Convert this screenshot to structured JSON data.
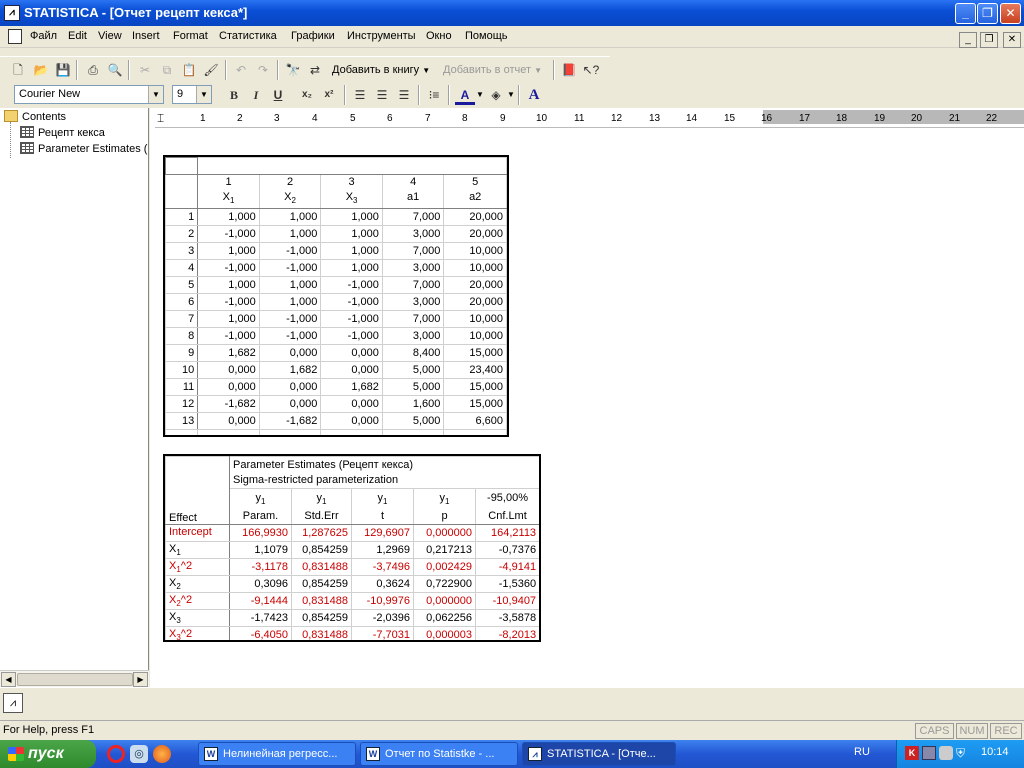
{
  "window": {
    "title": "STATISTICA - [Отчет рецепт кекса*]",
    "app_icon": "statistica-icon"
  },
  "menu": [
    "Файл",
    "Edit",
    "View",
    "Insert",
    "Format",
    "Статистика",
    "Графики",
    "Инструменты",
    "Окно",
    "Помощь"
  ],
  "toolbar": {
    "add_to_workbook": "Добавить в книгу",
    "add_to_report": "Добавить в отчет",
    "font_name": "Courier New",
    "font_size": "9",
    "bold": "B",
    "italic": "I",
    "underline": "U",
    "subscript": "x₂",
    "superscript": "x²",
    "text_color": "A",
    "font_a": "A"
  },
  "tree": {
    "root": "Contents",
    "items": [
      "Рецепт кекса",
      "Parameter Estimates ("
    ]
  },
  "ruler": {
    "ticks": [
      "1",
      "2",
      "3",
      "4",
      "5",
      "6",
      "7",
      "8",
      "9",
      "10",
      "11",
      "12",
      "13",
      "14",
      "15",
      "16",
      "17",
      "18",
      "19",
      "20",
      "21",
      "22"
    ]
  },
  "table1": {
    "col_nums": [
      "1",
      "2",
      "3",
      "4",
      "5"
    ],
    "col_names": [
      "X",
      "X",
      "X",
      "a1",
      "a2"
    ],
    "col_subs": [
      "1",
      "2",
      "3",
      "",
      ""
    ],
    "rows": [
      [
        "1",
        "1,000",
        "1,000",
        "1,000",
        "7,000",
        "20,000"
      ],
      [
        "2",
        "-1,000",
        "1,000",
        "1,000",
        "3,000",
        "20,000"
      ],
      [
        "3",
        "1,000",
        "-1,000",
        "1,000",
        "7,000",
        "10,000"
      ],
      [
        "4",
        "-1,000",
        "-1,000",
        "1,000",
        "3,000",
        "10,000"
      ],
      [
        "5",
        "1,000",
        "1,000",
        "-1,000",
        "7,000",
        "20,000"
      ],
      [
        "6",
        "-1,000",
        "1,000",
        "-1,000",
        "3,000",
        "20,000"
      ],
      [
        "7",
        "1,000",
        "-1,000",
        "-1,000",
        "7,000",
        "10,000"
      ],
      [
        "8",
        "-1,000",
        "-1,000",
        "-1,000",
        "3,000",
        "10,000"
      ],
      [
        "9",
        "1,682",
        "0,000",
        "0,000",
        "8,400",
        "15,000"
      ],
      [
        "10",
        "0,000",
        "1,682",
        "0,000",
        "5,000",
        "23,400"
      ],
      [
        "11",
        "0,000",
        "0,000",
        "1,682",
        "5,000",
        "15,000"
      ],
      [
        "12",
        "-1,682",
        "0,000",
        "0,000",
        "1,600",
        "15,000"
      ],
      [
        "13",
        "0,000",
        "-1,682",
        "0,000",
        "5,000",
        "6,600"
      ]
    ]
  },
  "table2": {
    "title_line1": "Parameter Estimates (Рецепт кекса)",
    "title_line2": "Sigma-restricted parameterization",
    "effect_header": "Effect",
    "col_top": [
      "y",
      "y",
      "y",
      "y",
      "-95,00%"
    ],
    "col_sub": [
      "1",
      "1",
      "1",
      "1",
      ""
    ],
    "col_bottom": [
      "Param.",
      "Std.Err",
      "t",
      "p",
      "Cnf.Lmt"
    ],
    "rows": [
      {
        "effect": "Intercept",
        "sub": "",
        "sup": "",
        "vals": [
          "166,9930",
          "1,287625",
          "129,6907",
          "0,000000",
          "164,2113"
        ],
        "red": true
      },
      {
        "effect": "X",
        "sub": "1",
        "sup": "",
        "vals": [
          "1,1079",
          "0,854259",
          "1,2969",
          "0,217213",
          "-0,7376"
        ],
        "red": false
      },
      {
        "effect": "X",
        "sub": "1",
        "sup": "^2",
        "vals": [
          "-3,1178",
          "0,831488",
          "-3,7496",
          "0,002429",
          "-4,9141"
        ],
        "red": true
      },
      {
        "effect": "X",
        "sub": "2",
        "sup": "",
        "vals": [
          "0,3096",
          "0,854259",
          "0,3624",
          "0,722900",
          "-1,5360"
        ],
        "red": false
      },
      {
        "effect": "X",
        "sub": "2",
        "sup": "^2",
        "vals": [
          "-9,1444",
          "0,831488",
          "-10,9976",
          "0,000000",
          "-10,9407"
        ],
        "red": true
      },
      {
        "effect": "X",
        "sub": "3",
        "sup": "",
        "vals": [
          "-1,7423",
          "0,854259",
          "-2,0396",
          "0,062256",
          "-3,5878"
        ],
        "red": false
      },
      {
        "effect": "X",
        "sub": "3",
        "sup": "^2",
        "vals": [
          "-6,4050",
          "0,831488",
          "-7,7031",
          "0,000003",
          "-8,2013"
        ],
        "red": true
      }
    ]
  },
  "status": {
    "help": "For Help, press F1",
    "caps": "CAPS",
    "num": "NUM",
    "rec": "REC"
  },
  "taskbar": {
    "start": "пуск",
    "tasks": [
      "Нелинейная регресс...",
      "Отчет по Statistke - ...",
      "STATISTICA - [Отче..."
    ],
    "lang": "RU",
    "clock": "10:14"
  }
}
